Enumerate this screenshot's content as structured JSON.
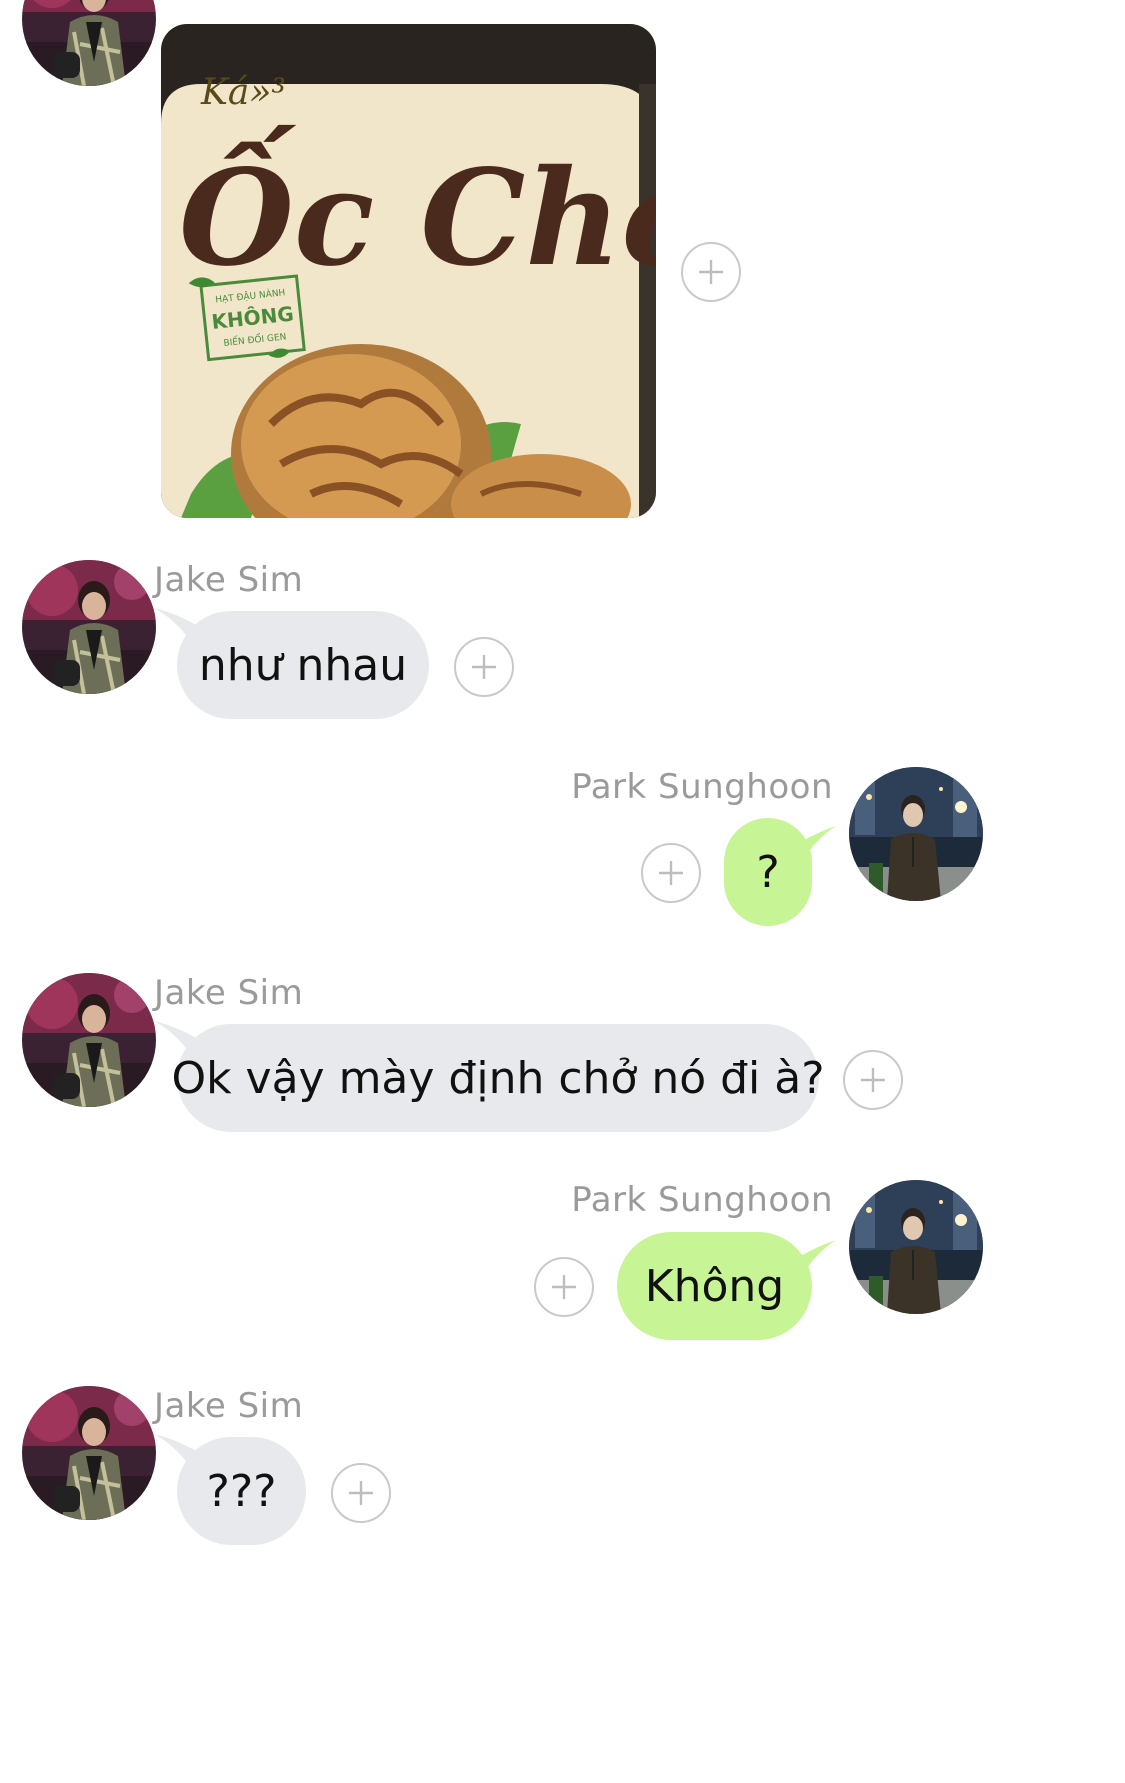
{
  "photo_message": {
    "brand_text": "Ốc Chó",
    "badge_lines": [
      "HẠT ĐẬU NÀNH",
      "KHÔNG",
      "BIẾN ĐỔI GEN"
    ]
  },
  "messages": [
    {
      "sender": "Jake Sim",
      "text": "như nhau"
    },
    {
      "sender": "Park Sunghoon",
      "text": "?"
    },
    {
      "sender": "Jake Sim",
      "text": "Ok vậy mày định chở nó đi à?"
    },
    {
      "sender": "Park Sunghoon",
      "text": "Không"
    },
    {
      "sender": "Jake Sim",
      "text": "???"
    }
  ],
  "colors": {
    "incoming_bubble": "#e8e9ec",
    "outgoing_bubble": "#c7f596",
    "sender_name": "#9a9a9a"
  },
  "icons": {
    "add_reaction": "plus-circle-icon"
  }
}
